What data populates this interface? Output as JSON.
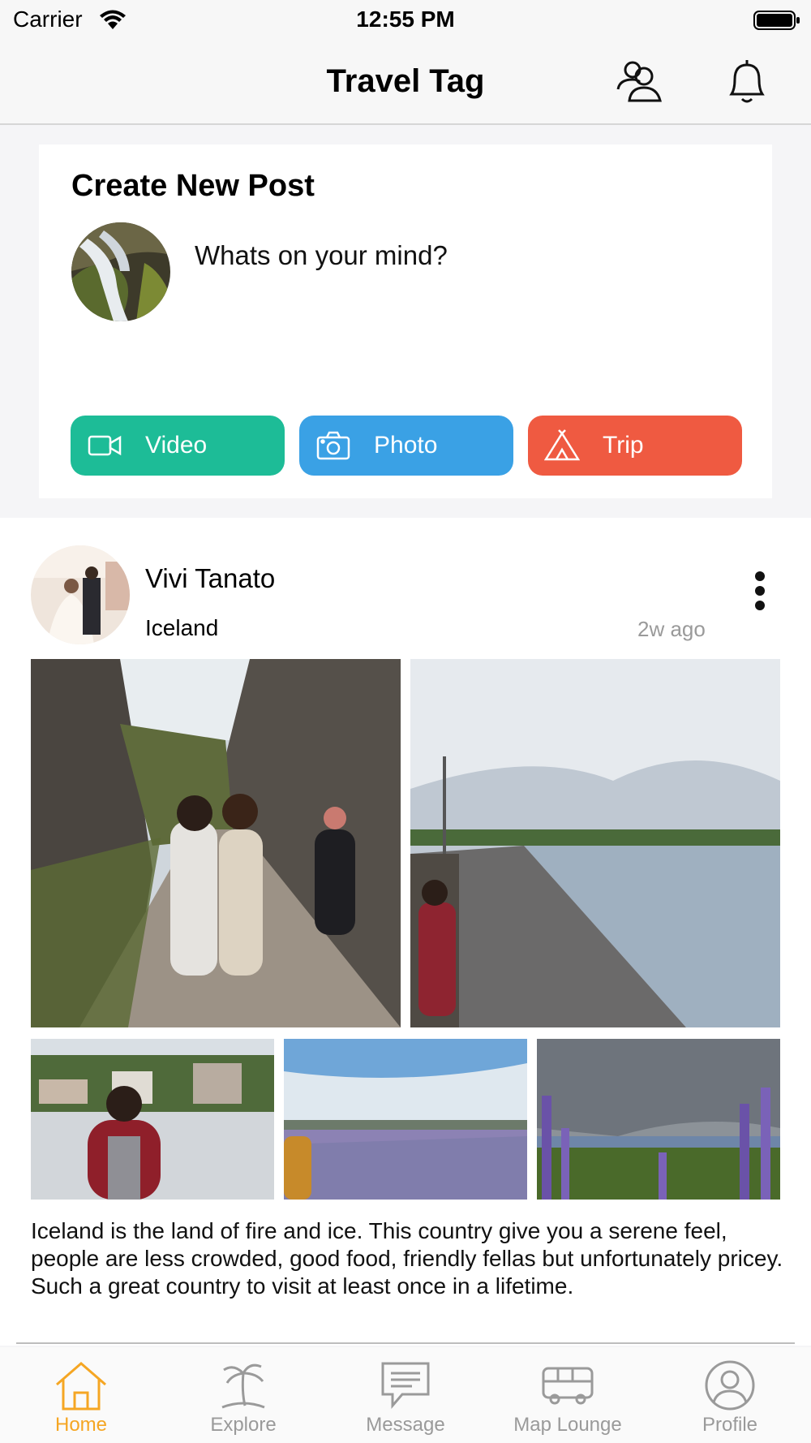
{
  "status_bar": {
    "carrier": "Carrier",
    "time": "12:55 PM"
  },
  "nav": {
    "title": "Travel Tag",
    "icons": [
      "people-icon",
      "bell-icon"
    ]
  },
  "create_post": {
    "title": "Create New Post",
    "placeholder": "Whats on your mind?",
    "buttons": [
      {
        "label": "Video",
        "icon": "video-camera-icon",
        "color": "#1dbc97"
      },
      {
        "label": "Photo",
        "icon": "camera-icon",
        "color": "#3aa1e5"
      },
      {
        "label": "Trip",
        "icon": "tent-icon",
        "color": "#ef5a41"
      }
    ]
  },
  "post": {
    "author": "Vivi Tanato",
    "location": "Iceland",
    "time": "2w ago",
    "text": "Iceland is the land of fire and ice. This country give you a serene feel, people are less crowded, good food, friendly fellas but unfortunately pricey. Such a great country to visit at least once in a lifetime."
  },
  "tabs": [
    {
      "label": "Home",
      "icon": "home-icon",
      "active": true
    },
    {
      "label": "Explore",
      "icon": "palm-tree-icon",
      "active": false
    },
    {
      "label": "Message",
      "icon": "chat-bubble-icon",
      "active": false
    },
    {
      "label": "Map Lounge",
      "icon": "bus-icon",
      "active": false
    },
    {
      "label": "Profile",
      "icon": "user-icon",
      "active": false
    }
  ],
  "colors": {
    "accent": "#f5a623",
    "inactive_tab": "#9a9a9a"
  }
}
